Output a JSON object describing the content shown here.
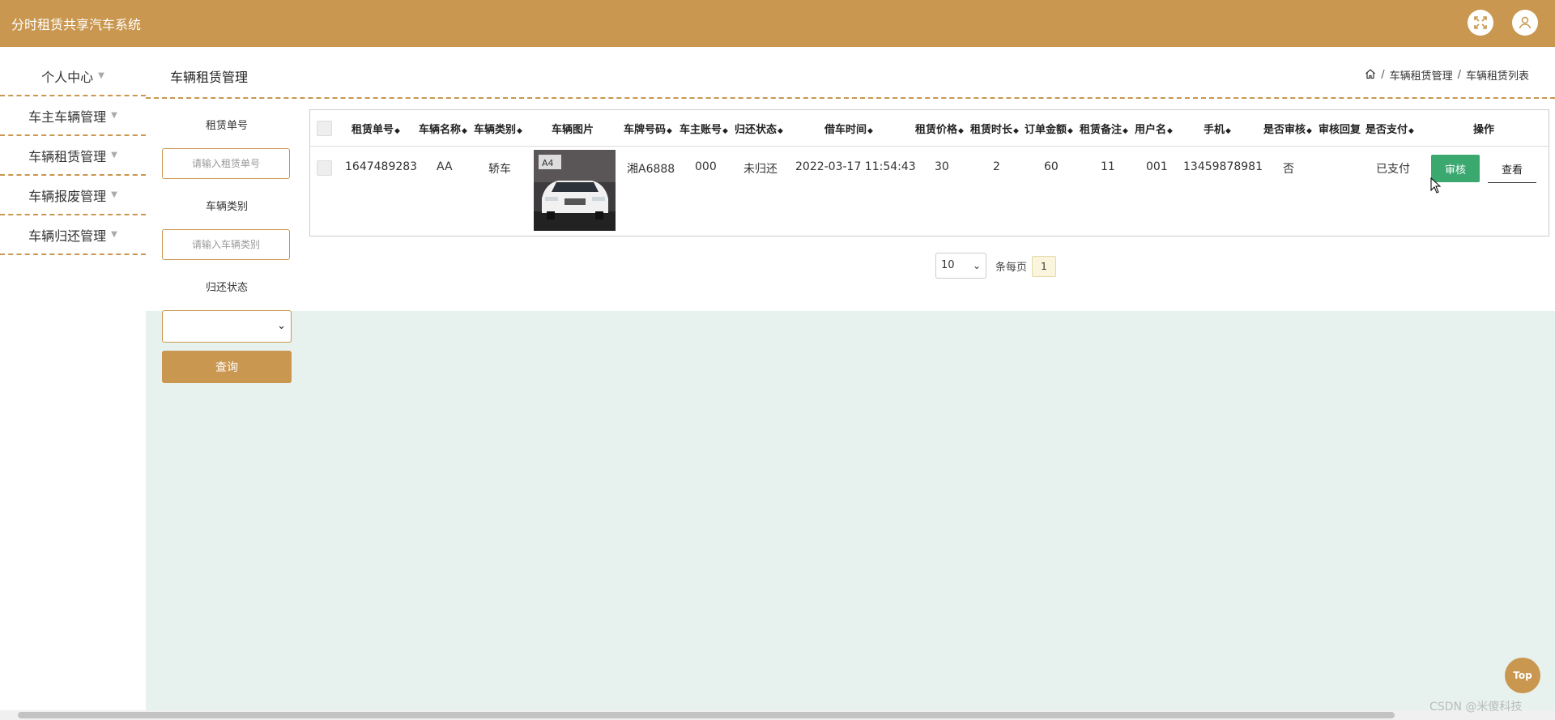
{
  "app": {
    "title": "分时租赁共享汽车系统"
  },
  "sidebar": {
    "items": [
      {
        "label": "个人中心"
      },
      {
        "label": "车主车辆管理"
      },
      {
        "label": "车辆租赁管理"
      },
      {
        "label": "车辆报废管理"
      },
      {
        "label": "车辆归还管理"
      }
    ]
  },
  "page": {
    "title": "车辆租赁管理"
  },
  "breadcrumb": {
    "items": [
      "车辆租赁管理",
      "车辆租赁列表"
    ]
  },
  "filters": {
    "order_no_label": "租赁单号",
    "order_no_placeholder": "请输入租赁单号",
    "category_label": "车辆类别",
    "category_placeholder": "请输入车辆类别",
    "return_status_label": "归还状态",
    "return_status_value": "",
    "query_button": "查询"
  },
  "table": {
    "columns": [
      "租赁单号",
      "车辆名称",
      "车辆类别",
      "车辆图片",
      "车牌号码",
      "车主账号",
      "归还状态",
      "借车时间",
      "租赁价格",
      "租赁时长",
      "订单金额",
      "租赁备注",
      "用户名",
      "手机",
      "是否审核",
      "审核回复",
      "是否支付",
      "操作"
    ],
    "rows": [
      {
        "order_no": "1647489283",
        "car_name": "AA",
        "category": "轿车",
        "plate": "湘A6888",
        "owner_account": "000",
        "return_status": "未归还",
        "borrow_time": "2022-03-17 11:54:43",
        "price": "30",
        "duration": "2",
        "amount": "60",
        "remark": "11",
        "username": "001",
        "phone": "13459878981",
        "reviewed": "否",
        "review_reply": "",
        "paid": "已支付",
        "audit_btn": "审核",
        "view_btn": "查看"
      }
    ]
  },
  "pagination": {
    "page_size": "10",
    "per_page_text": "条每页",
    "current_page": "1"
  },
  "top_button": "Top",
  "watermark": "CSDN @米傻科技",
  "colors": {
    "brand": "#c9974f",
    "audit": "#3aa86f",
    "content_bg": "#e7f2ee"
  }
}
